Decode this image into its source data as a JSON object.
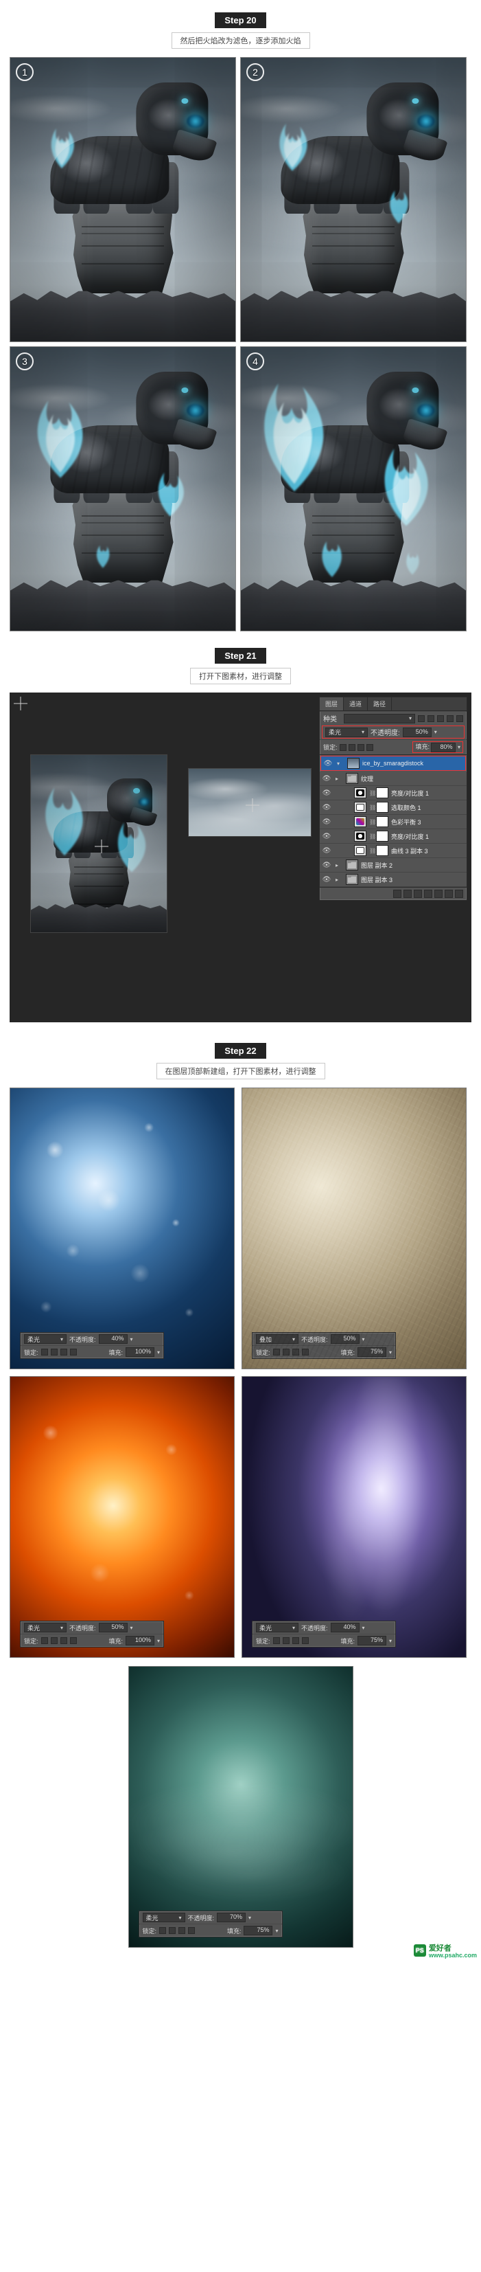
{
  "step20": {
    "badge": "Step 20",
    "desc": "然后把火焰改为滤色，逐步添加火焰",
    "tiles": [
      "1",
      "2",
      "3",
      "4"
    ]
  },
  "step21": {
    "badge": "Step 21",
    "desc": "打开下图素材，进行调整",
    "panel": {
      "tabs": [
        "图层",
        "通道",
        "路径"
      ],
      "kind_label": "种类",
      "blend_label": "柔光",
      "opacity_label": "不透明度:",
      "opacity_value": "50%",
      "lock_label": "锁定:",
      "fill_label": "填充:",
      "fill_value": "80%",
      "layers": [
        {
          "eye": "👁",
          "tw": "▾",
          "type": "img1",
          "name": "ice_by_smaragdistock",
          "sel": true
        },
        {
          "eye": "👁",
          "tw": "▸",
          "type": "folder",
          "name": "纹理",
          "indent": 0
        },
        {
          "eye": "👁",
          "tw": "",
          "type": "adj-bc",
          "mask": "mask",
          "name": "亮度/对比度 1",
          "indent": 1
        },
        {
          "eye": "👁",
          "tw": "",
          "type": "adj-curve",
          "mask": "mask",
          "name": "选取颜色 1",
          "indent": 1
        },
        {
          "eye": "👁",
          "tw": "",
          "type": "adj-cb",
          "mask": "mask",
          "name": "色彩平衡 3",
          "indent": 1
        },
        {
          "eye": "👁",
          "tw": "",
          "type": "adj-bc",
          "mask": "mask",
          "name": "亮度/对比度 1",
          "indent": 1
        },
        {
          "eye": "👁",
          "tw": "",
          "type": "adj-curve",
          "mask": "mask",
          "name": "曲线 3 副本 3",
          "indent": 1
        },
        {
          "eye": "👁",
          "tw": "▸",
          "type": "folder",
          "name": "图层 副本 2",
          "indent": 0
        },
        {
          "eye": "👁",
          "tw": "▸",
          "type": "folder",
          "name": "图层 副本 3",
          "indent": 0
        }
      ]
    }
  },
  "step22": {
    "badge": "Step 22",
    "desc": "在图层顶部新建组，打开下图素材，进行调整",
    "textures": [
      {
        "blend": "柔光",
        "op_label": "不透明度:",
        "op": "40%",
        "lock": "锁定:",
        "fill_label": "填充:",
        "fill": "100%"
      },
      {
        "blend": "叠加",
        "op_label": "不透明度:",
        "op": "50%",
        "lock": "锁定:",
        "fill_label": "填充:",
        "fill": "75%"
      },
      {
        "blend": "柔光",
        "op_label": "不透明度:",
        "op": "50%",
        "lock": "锁定:",
        "fill_label": "填充:",
        "fill": "100%"
      },
      {
        "blend": "柔光",
        "op_label": "不透明度:",
        "op": "40%",
        "lock": "锁定:",
        "fill_label": "填充:",
        "fill": "75%"
      },
      {
        "blend": "柔光",
        "op_label": "不透明度:",
        "op": "70%",
        "lock": "锁定:",
        "fill_label": "填充:",
        "fill": "75%"
      }
    ]
  },
  "watermark": {
    "logo": "PS",
    "text": "爱好者",
    "sub": "www.psahc.com"
  },
  "chev": "▾"
}
